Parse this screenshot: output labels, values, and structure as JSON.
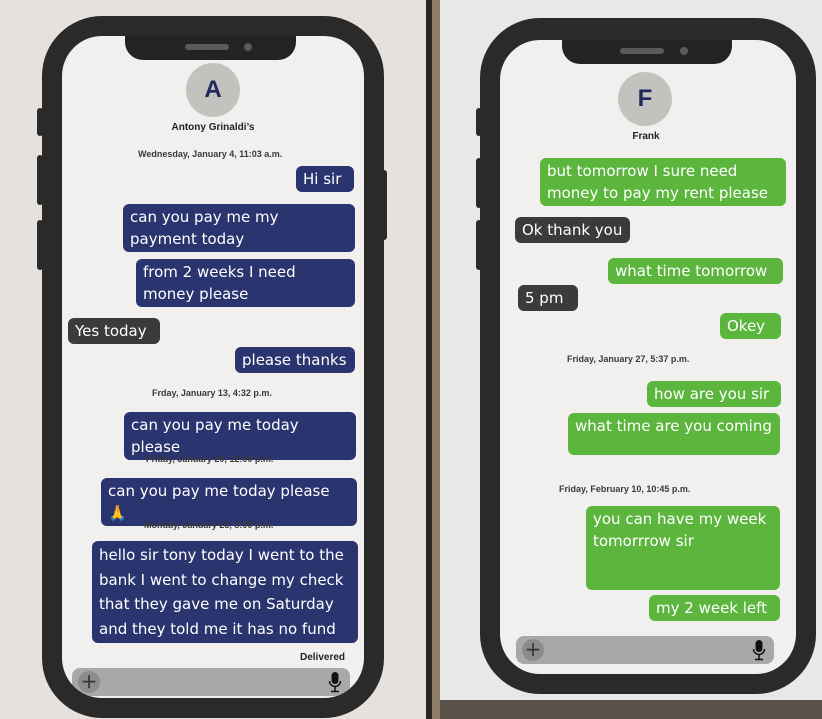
{
  "left_phone": {
    "avatar_letter": "A",
    "contact_name": "Antony Grinaldi’s",
    "theme_color": "#2a346e",
    "messages": [
      {
        "type": "timestamp",
        "text": "Wednesday, January 4, 11:03 a.m."
      },
      {
        "type": "sent",
        "text": "Hi sir"
      },
      {
        "type": "sent",
        "text": "can you pay me my payment today"
      },
      {
        "type": "sent",
        "text": "from 2 weeks I need money please"
      },
      {
        "type": "received",
        "text": "Yes today"
      },
      {
        "type": "sent",
        "text": "please thanks"
      },
      {
        "type": "timestamp",
        "text": "Frday, January 13, 4:32 p.m."
      },
      {
        "type": "sent",
        "text": "can you pay me today please"
      },
      {
        "type": "timestamp",
        "text": "Friday, January 20, 12:00 p.m."
      },
      {
        "type": "sent",
        "text": "can you pay me today please 🙏"
      },
      {
        "type": "timestamp",
        "text": "Monday, January 23, 8:00 p.m."
      },
      {
        "type": "sent",
        "text": "hello sir tony today I went to the bank I went to change my check that they gave me on Saturday and they told me it has no fund"
      }
    ],
    "status": "Delivered",
    "input": {
      "add_icon": "plus-icon",
      "mic_icon": "microphone-icon",
      "value": ""
    }
  },
  "right_phone": {
    "avatar_letter": "F",
    "contact_name": "Frank",
    "theme_color": "#5cb63d",
    "messages": [
      {
        "type": "sent",
        "text": "but tomorrow I sure need money to pay my rent please"
      },
      {
        "type": "received",
        "text": "Ok thank you"
      },
      {
        "type": "sent",
        "text": "what time tomorrow"
      },
      {
        "type": "received",
        "text": "5 pm"
      },
      {
        "type": "sent",
        "text": "Okey"
      },
      {
        "type": "timestamp",
        "text": "Friday, January 27, 5:37 p.m."
      },
      {
        "type": "sent",
        "text": "how are you sir"
      },
      {
        "type": "sent",
        "text": "what time are you coming"
      },
      {
        "type": "timestamp",
        "text": "Friday, February 10, 10:45 p.m."
      },
      {
        "type": "sent",
        "text": "you can have my week tomorrrow sir"
      },
      {
        "type": "sent",
        "text": "my 2 week left"
      }
    ],
    "input": {
      "add_icon": "plus-icon",
      "mic_icon": "microphone-icon",
      "value": ""
    }
  }
}
